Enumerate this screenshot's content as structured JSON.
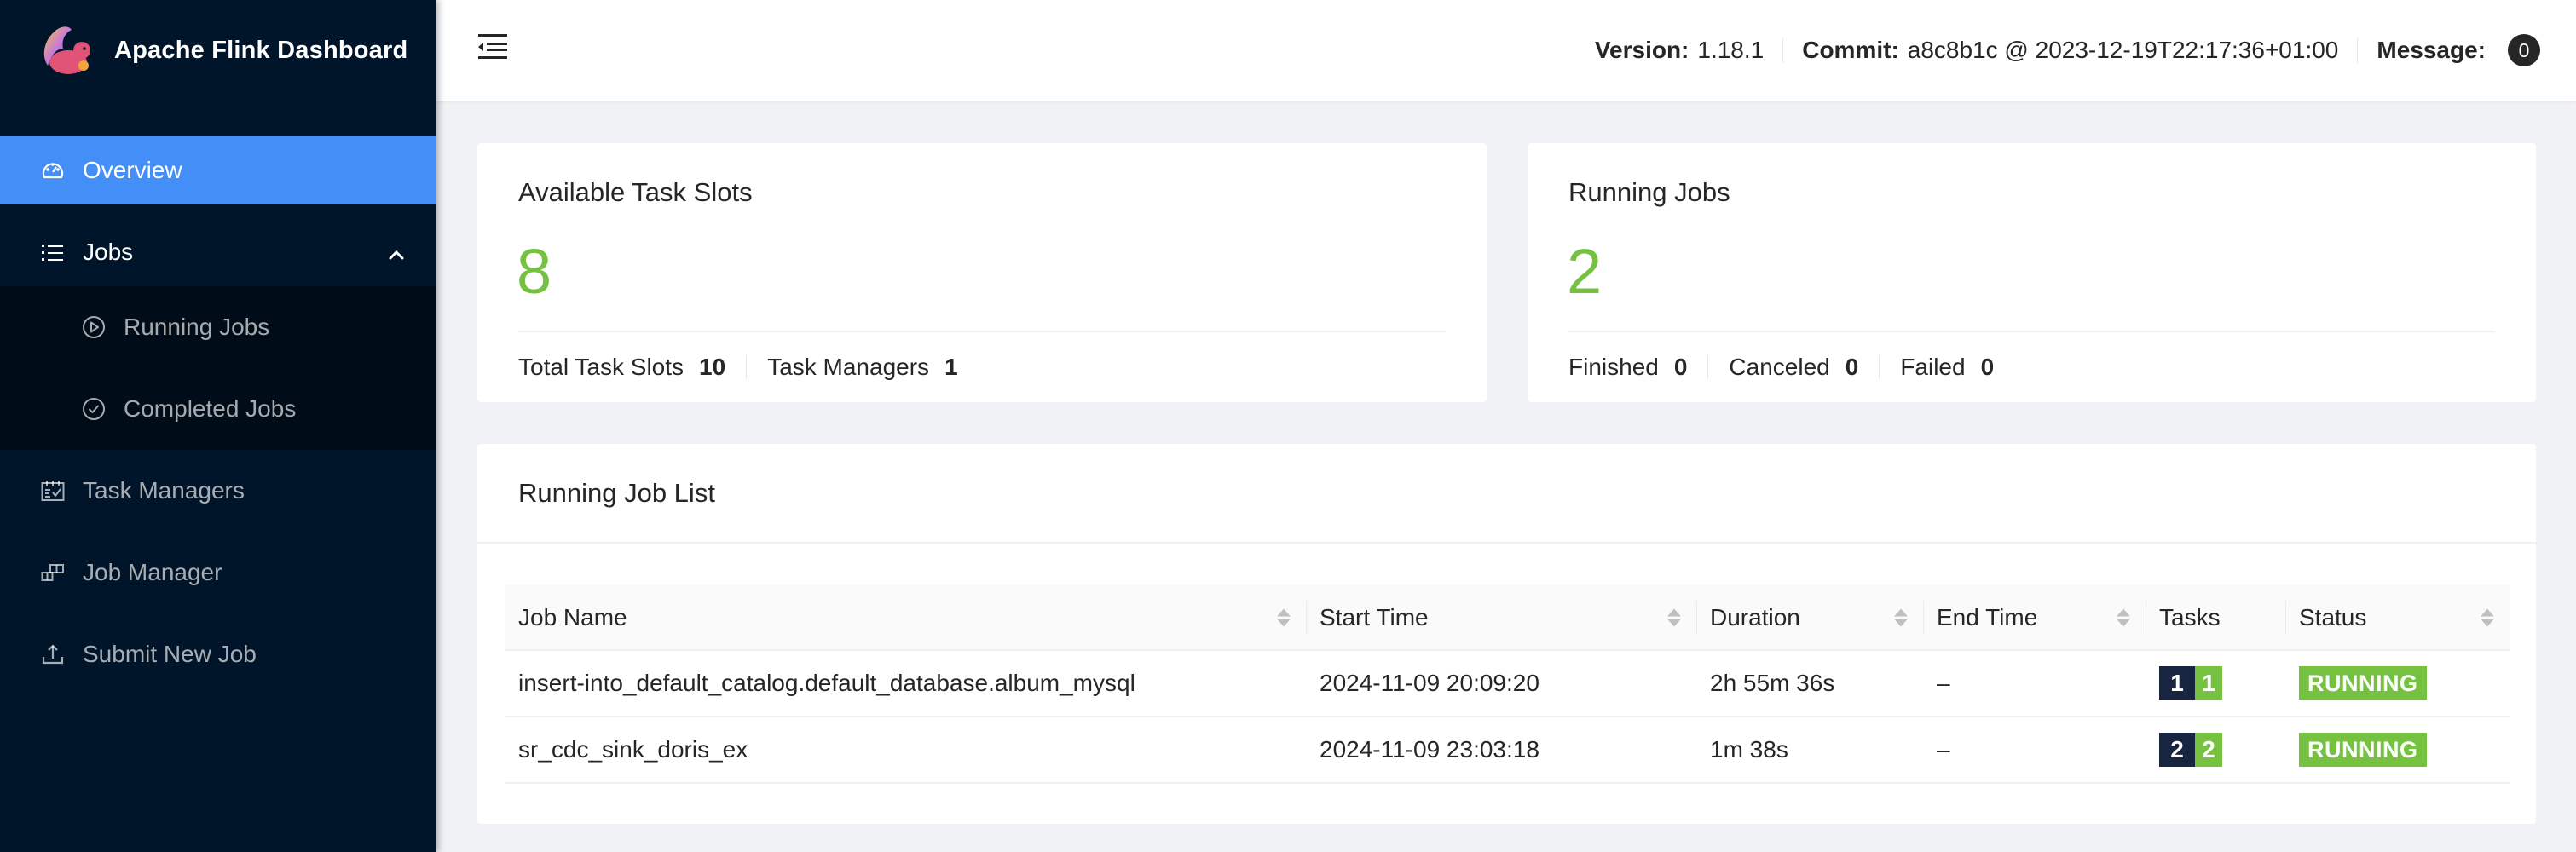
{
  "app": {
    "title": "Apache Flink Dashboard"
  },
  "sidebar": {
    "items": [
      {
        "label": "Overview",
        "icon": "dashboard-icon",
        "active": true
      },
      {
        "label": "Jobs",
        "icon": "list-icon",
        "expanded": true,
        "children": [
          {
            "label": "Running Jobs",
            "icon": "play-circle-icon"
          },
          {
            "label": "Completed Jobs",
            "icon": "check-circle-icon"
          }
        ]
      },
      {
        "label": "Task Managers",
        "icon": "schedule-icon"
      },
      {
        "label": "Job Manager",
        "icon": "build-icon"
      },
      {
        "label": "Submit New Job",
        "icon": "upload-icon"
      }
    ]
  },
  "header": {
    "version_label": "Version:",
    "version": "1.18.1",
    "commit_label": "Commit:",
    "commit": "a8c8b1c @ 2023-12-19T22:17:36+01:00",
    "message_label": "Message:",
    "message_count": "0"
  },
  "task_slots": {
    "title": "Available Task Slots",
    "value": "8",
    "total_label": "Total Task Slots",
    "total_value": "10",
    "tm_label": "Task Managers",
    "tm_value": "1"
  },
  "running_jobs": {
    "title": "Running Jobs",
    "value": "2",
    "finished_label": "Finished",
    "finished_value": "0",
    "canceled_label": "Canceled",
    "canceled_value": "0",
    "failed_label": "Failed",
    "failed_value": "0"
  },
  "job_list": {
    "title": "Running Job List",
    "columns": [
      "Job Name",
      "Start Time",
      "Duration",
      "End Time",
      "Tasks",
      "Status"
    ],
    "rows": [
      {
        "name": "insert-into_default_catalog.default_database.album_mysql",
        "start_time": "2024-11-09 20:09:20",
        "duration": "2h 55m 36s",
        "end_time": "–",
        "tasks_total": "1",
        "tasks_running": "1",
        "status": "RUNNING"
      },
      {
        "name": "sr_cdc_sink_doris_ex",
        "start_time": "2024-11-09 23:03:18",
        "duration": "1m 38s",
        "end_time": "–",
        "tasks_total": "2",
        "tasks_running": "2",
        "status": "RUNNING"
      }
    ]
  },
  "colors": {
    "sidebar_bg": "#001529",
    "submenu_bg": "#000c17",
    "active_item": "#448ef7",
    "success_green": "#76c140",
    "tasks_total_bg": "#172540"
  }
}
